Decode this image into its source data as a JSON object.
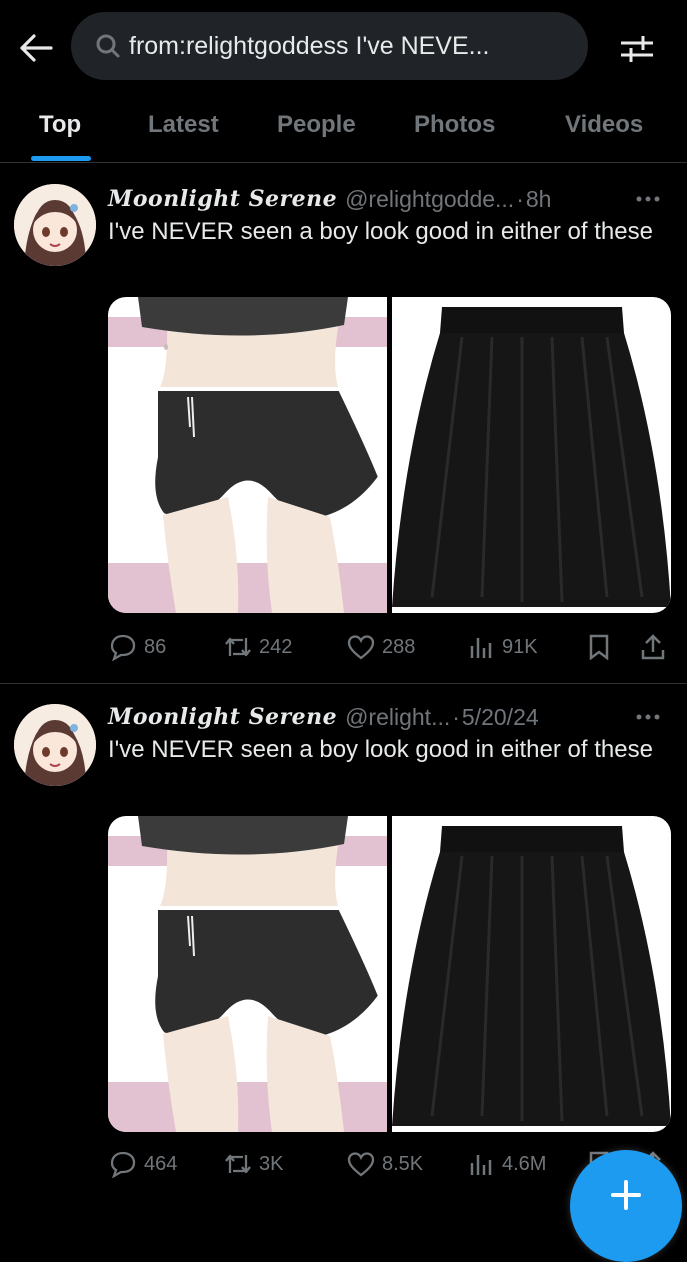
{
  "search": {
    "query": "from:relightgoddess I've NEVE..."
  },
  "tabs": [
    {
      "label": "Top"
    },
    {
      "label": "Latest"
    },
    {
      "label": "People"
    },
    {
      "label": "Photos"
    },
    {
      "label": "Videos"
    }
  ],
  "active_tab": "Top",
  "tweets": [
    {
      "display_name": "Moonlight Serene",
      "handle": "@relightgodde...",
      "separator": "·",
      "time": "8h",
      "text": "I've NEVER seen a boy look good in either of these",
      "replies": "86",
      "reposts": "242",
      "likes": "288",
      "views": "91K"
    },
    {
      "display_name": "Moonlight Serene",
      "handle": "@relight...",
      "separator": "·",
      "time": "5/20/24",
      "text": "I've NEVER seen a boy look good in either of these",
      "replies": "464",
      "reposts": "3K",
      "likes": "8.5K",
      "views": "4.6M"
    }
  ],
  "colors": {
    "accent": "#1d9bf0",
    "muted": "#71767b",
    "text": "#e7e9ea",
    "search_bg": "#202327"
  }
}
